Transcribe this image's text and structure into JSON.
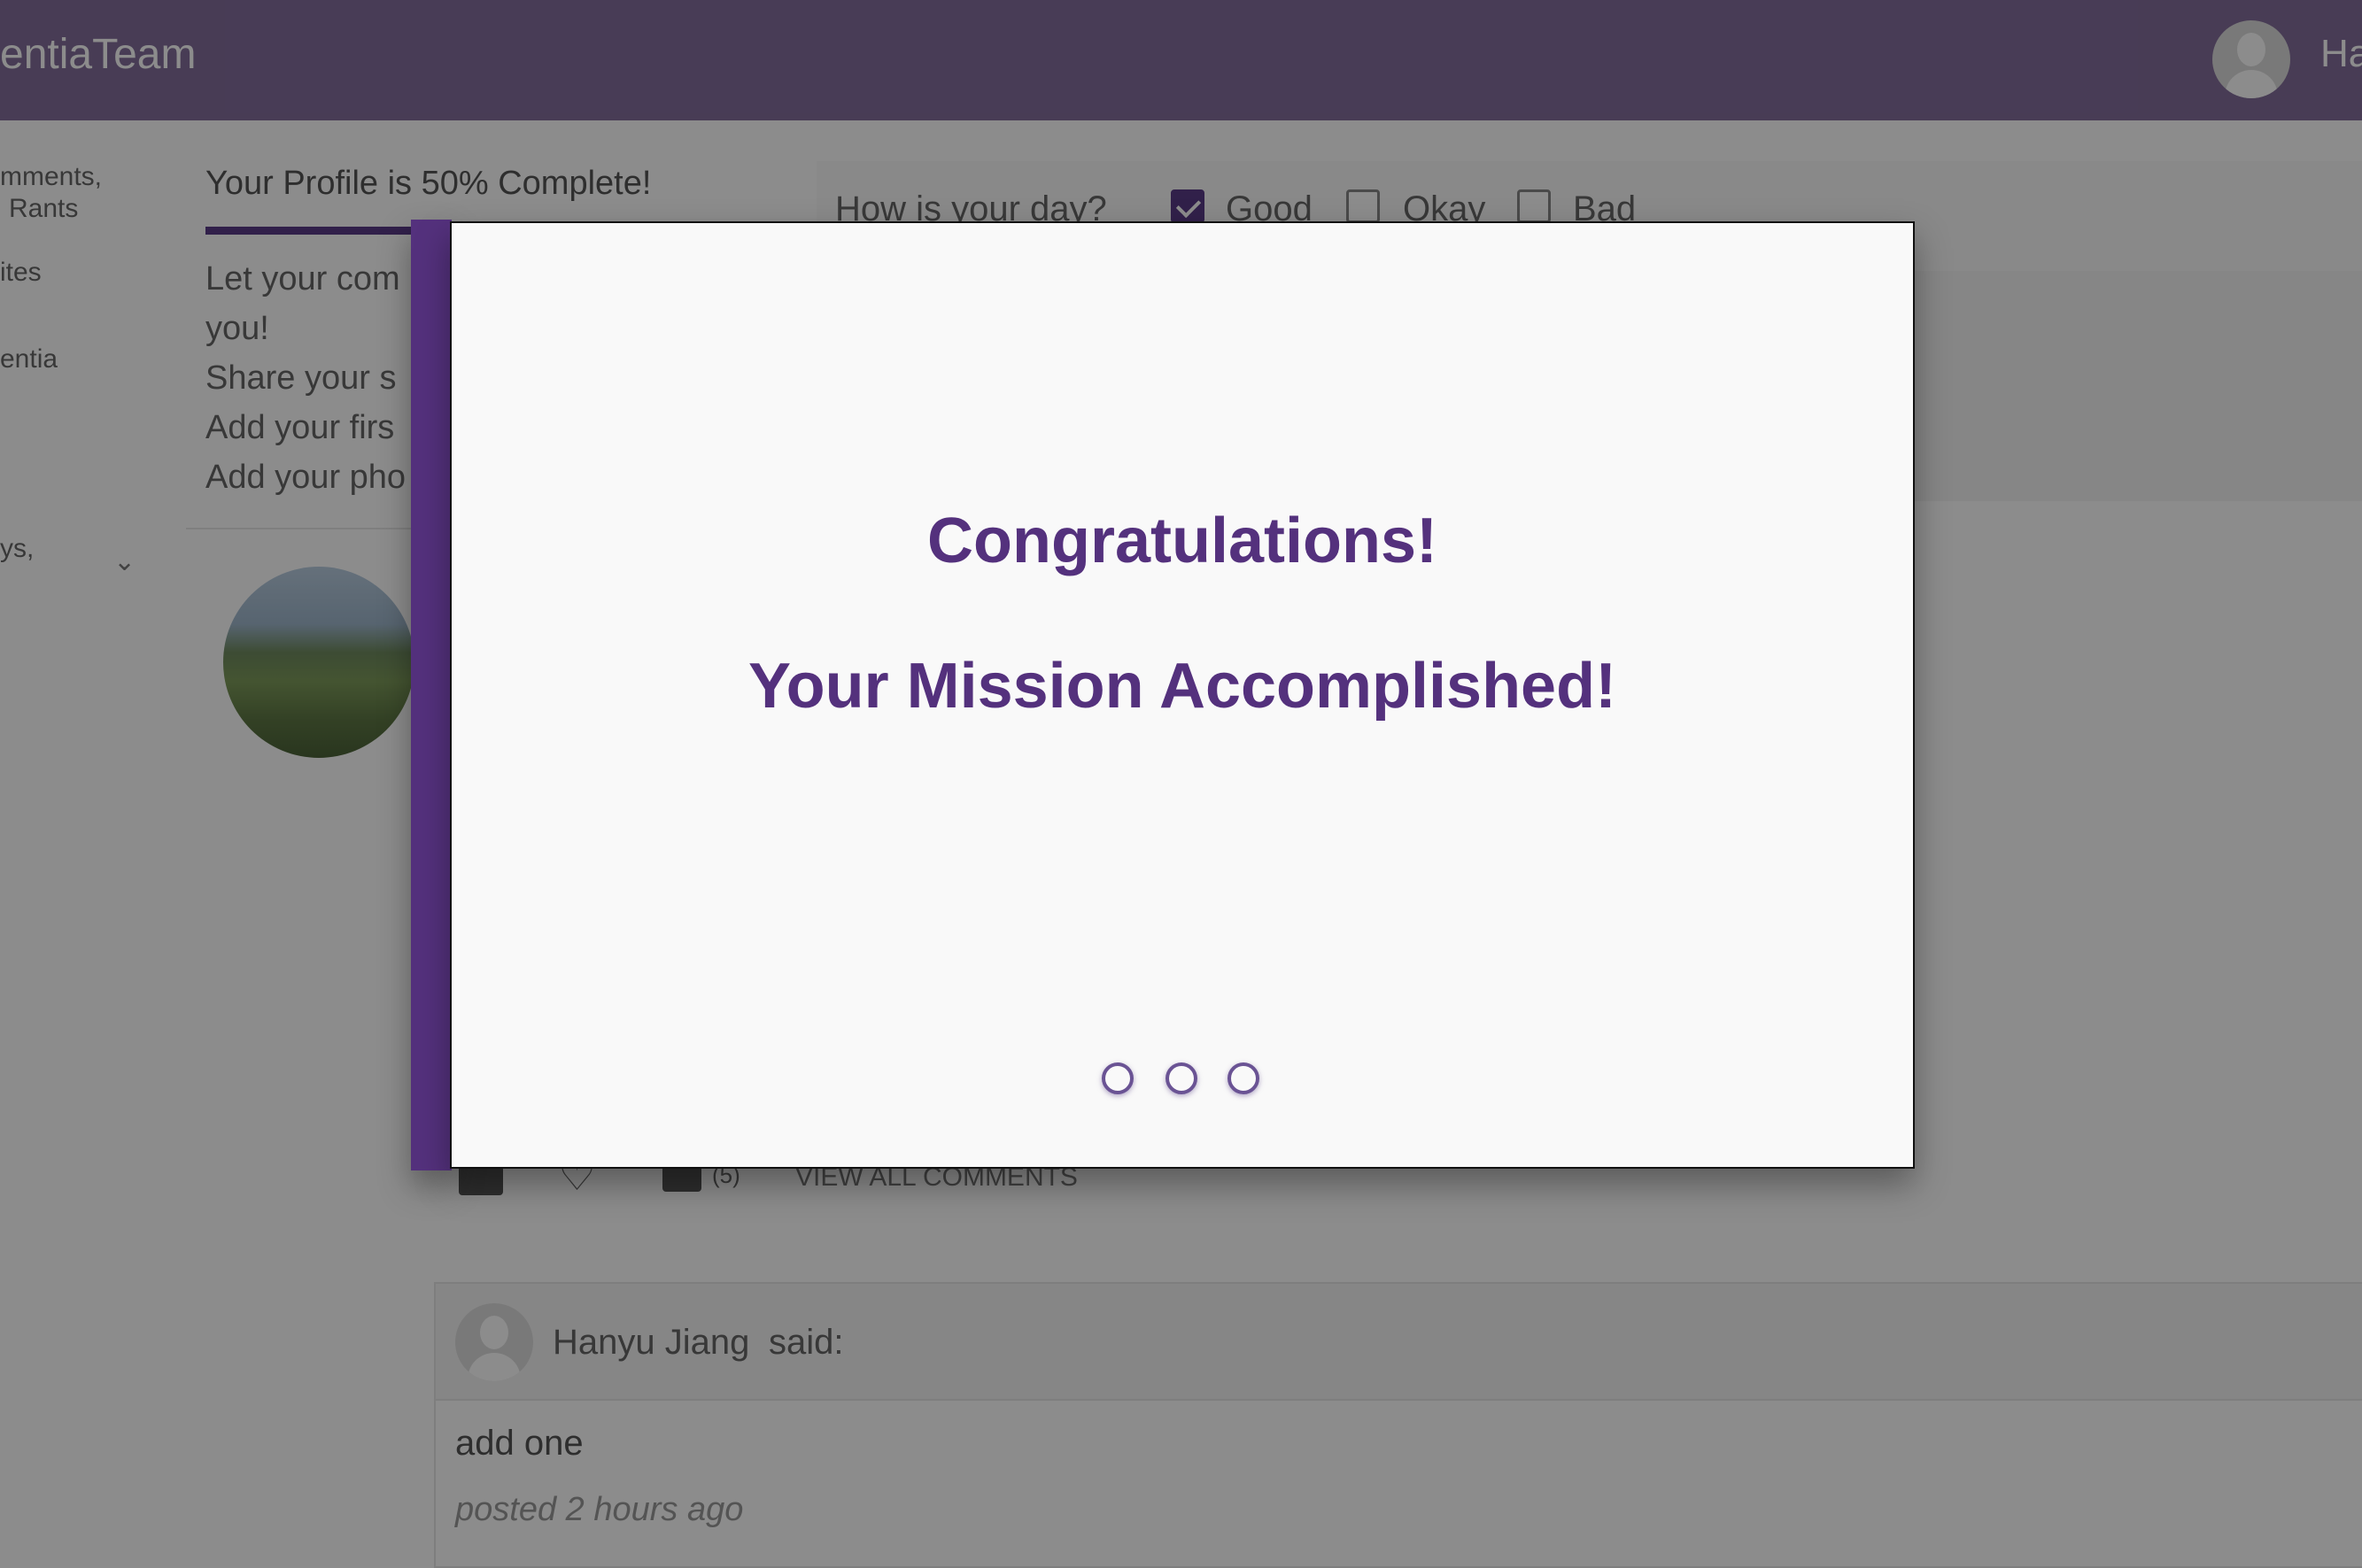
{
  "header": {
    "brand": "entiaTeam",
    "user_name": "Ha"
  },
  "sidebar": {
    "items": [
      {
        "label": "mments,"
      },
      {
        "label": "Rants"
      },
      {
        "label": "ites"
      },
      {
        "label": "entia"
      },
      {
        "label": "ys,"
      }
    ],
    "chevron": "chevron-down-icon"
  },
  "profile": {
    "title": "Your Profile is 50% Complete!",
    "completion_percent": 50,
    "tasks": [
      "Let your com",
      "you!",
      "Share your s",
      "Add your firs",
      "Add your pho"
    ]
  },
  "mood": {
    "question": "How is your day?",
    "options": [
      {
        "label": "Good",
        "checked": true
      },
      {
        "label": "Okay",
        "checked": false
      },
      {
        "label": "Bad",
        "checked": false
      }
    ]
  },
  "post_actions": {
    "comment_count": "(5)",
    "view_all": "VIEW ALL COMMENTS"
  },
  "comment": {
    "author": "Hanyu Jiang",
    "said": "said:",
    "text": "add one",
    "time": "posted 2 hours ago"
  },
  "modal": {
    "title": "Congratulations!",
    "subtitle": "Your Mission Accomplished!",
    "dots": 3
  },
  "colors": {
    "accent": "#54317d",
    "topbar": "#836e9c"
  }
}
